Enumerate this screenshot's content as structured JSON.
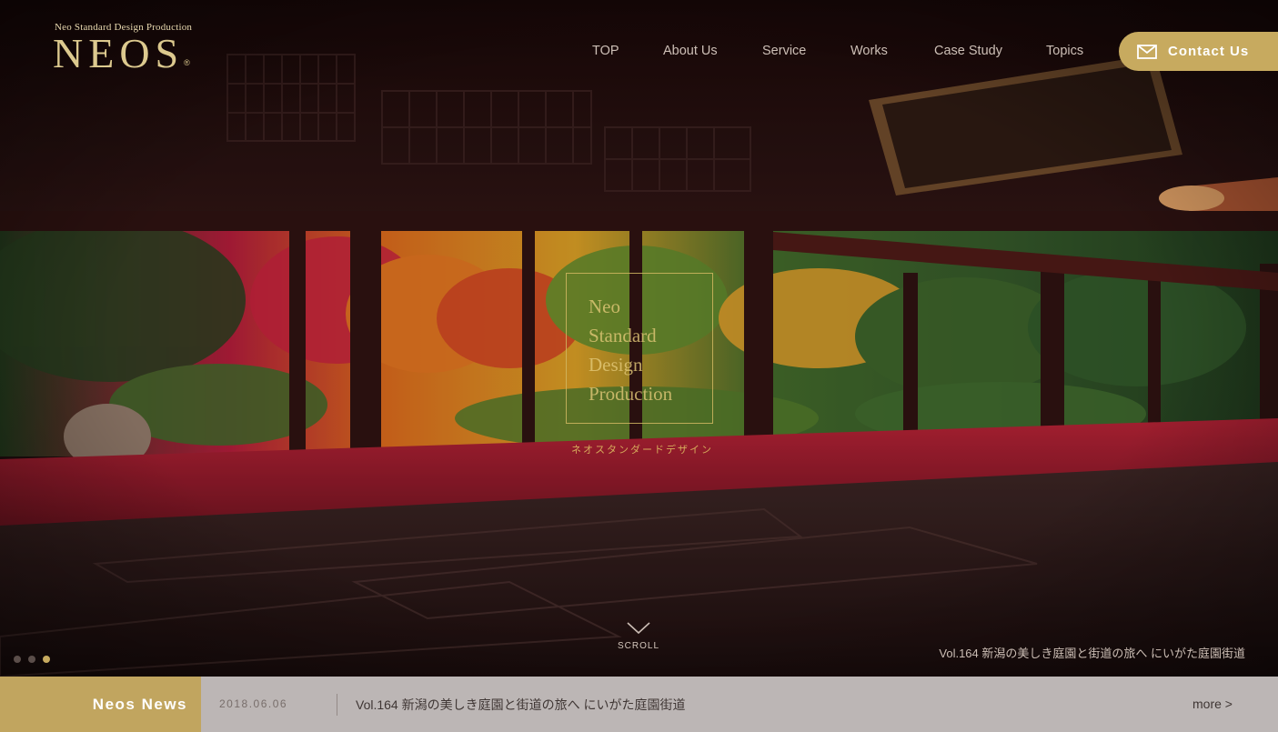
{
  "brand": {
    "tagline": "Neo Standard Design Production",
    "name": "NEOS",
    "reg_mark": "®"
  },
  "nav": {
    "items": [
      {
        "label": "TOP"
      },
      {
        "label": "About Us"
      },
      {
        "label": "Service"
      },
      {
        "label": "Works"
      },
      {
        "label": "Case Study"
      },
      {
        "label": "Topics"
      }
    ],
    "contact_label": "Contact Us",
    "contact_icon": "mail-icon"
  },
  "hero": {
    "emblem_lines": [
      "Neo",
      "Standard",
      "Design",
      "Production"
    ],
    "emblem_sub": "ネオスタンダードデザイン",
    "scroll_label": "SCROLL",
    "caption": "Vol.164 新潟の美しき庭園と街道の旅へ にいがた庭園街道",
    "slides_total": 3,
    "active_slide": 3
  },
  "news": {
    "label": "Neos News",
    "date": "2018.06.06",
    "title": "Vol.164 新潟の美しき庭園と街道の旅へ にいがた庭園街道",
    "more": "more >"
  },
  "colors": {
    "accent_gold": "#c7aa5f",
    "news_bar": "#bcb6b5"
  }
}
